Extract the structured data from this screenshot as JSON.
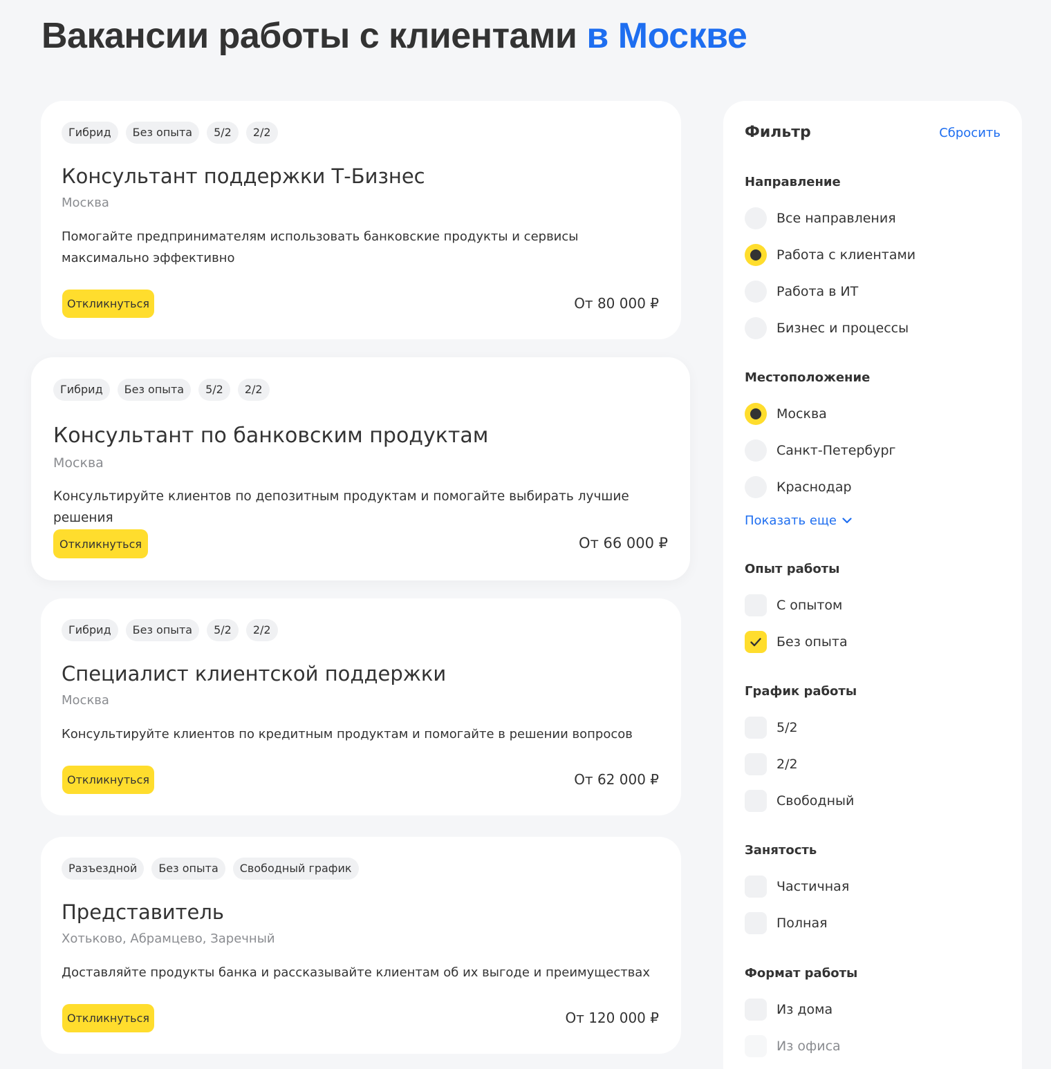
{
  "header": {
    "title_main": "Вакансии работы с клиентами",
    "title_accent": "в Москве"
  },
  "jobs": [
    {
      "tags": [
        "Гибрид",
        "Без опыта",
        "5/2",
        "2/2"
      ],
      "title": "Консультант поддержки Т-Бизнес",
      "city": "Москва",
      "description": "Помогайте предпринимателям использовать банковские продукты и сервисы максимально эффективно",
      "apply_label": "Откликнуться",
      "salary": "От 80 000 ₽"
    },
    {
      "tags": [
        "Гибрид",
        "Без опыта",
        "5/2",
        "2/2"
      ],
      "title": "Консультант по банковским продуктам",
      "city": "Москва",
      "description": "Консультируйте клиентов по депозитным продуктам и помогайте выбирать лучшие решения",
      "apply_label": "Откликнуться",
      "salary": "От 66 000 ₽"
    },
    {
      "tags": [
        "Гибрид",
        "Без опыта",
        "5/2",
        "2/2"
      ],
      "title": "Специалист клиентской поддержки",
      "city": "Москва",
      "description": "Консультируйте клиентов по кредитным продуктам и помогайте в решении вопросов",
      "apply_label": "Откликнуться",
      "salary": "От 62 000 ₽"
    },
    {
      "tags": [
        "Разъездной",
        "Без опыта",
        "Свободный график"
      ],
      "title": "Представитель",
      "city": "Хотьково, Абрамцево, Заречный",
      "description": "Доставляйте продукты банка и рассказывайте клиентам об их выгоде и преимуществах",
      "apply_label": "Откликнуться",
      "salary": "От 120 000 ₽"
    }
  ],
  "filter": {
    "title": "Фильтр",
    "reset_label": "Сбросить",
    "direction": {
      "title": "Направление",
      "options": [
        {
          "label": "Все направления",
          "selected": false
        },
        {
          "label": "Работа с клиентами",
          "selected": true
        },
        {
          "label": "Работа в ИТ",
          "selected": false
        },
        {
          "label": "Бизнес и процессы",
          "selected": false
        }
      ]
    },
    "location": {
      "title": "Местоположение",
      "options": [
        {
          "label": "Москва",
          "selected": true
        },
        {
          "label": "Санкт-Петербург",
          "selected": false
        },
        {
          "label": "Краснодар",
          "selected": false
        }
      ],
      "show_more_label": "Показать еще"
    },
    "experience": {
      "title": "Опыт работы",
      "options": [
        {
          "label": "С опытом",
          "checked": false
        },
        {
          "label": "Без опыта",
          "checked": true
        }
      ]
    },
    "schedule": {
      "title": "График работы",
      "options": [
        {
          "label": "5/2",
          "checked": false
        },
        {
          "label": "2/2",
          "checked": false
        },
        {
          "label": "Свободный",
          "checked": false
        }
      ]
    },
    "employment": {
      "title": "Занятость",
      "options": [
        {
          "label": "Частичная",
          "checked": false
        },
        {
          "label": "Полная",
          "checked": false
        }
      ]
    },
    "work_format": {
      "title": "Формат работы",
      "options": [
        {
          "label": "Из дома",
          "checked": false
        },
        {
          "label": "Из офиса",
          "checked": false
        }
      ]
    }
  },
  "colors": {
    "accent_blue": "#1e6ef0",
    "accent_yellow": "#ffdd2d",
    "background": "#f5f6f8"
  }
}
